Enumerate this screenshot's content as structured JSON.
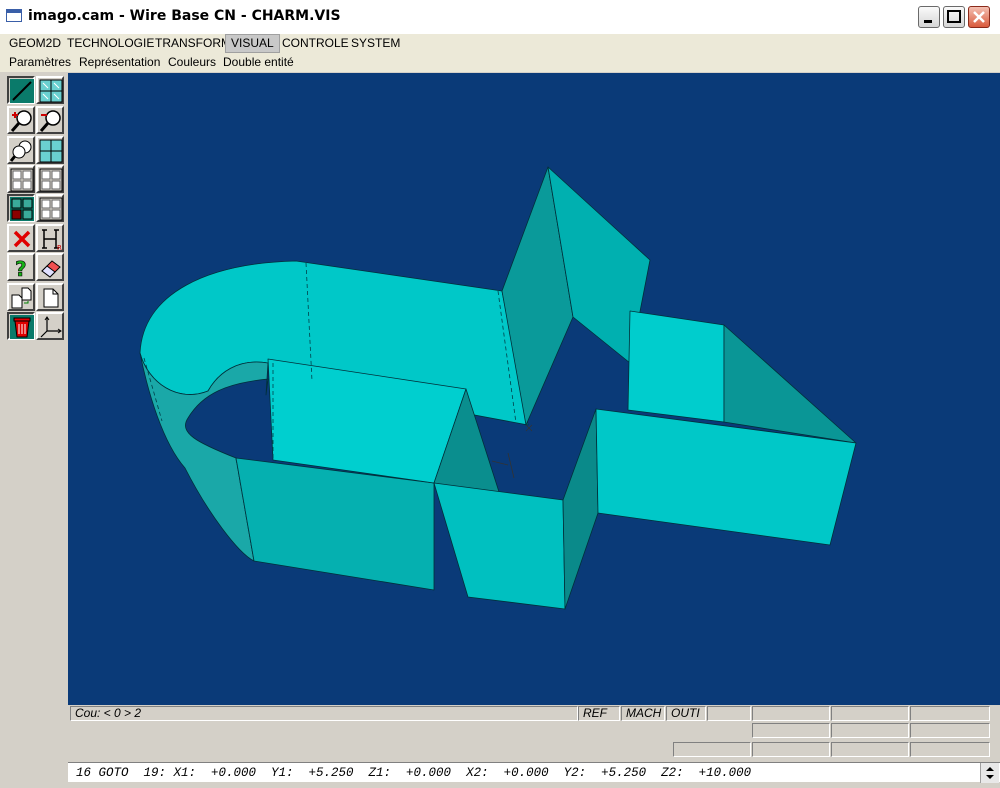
{
  "window": {
    "title": "imago.cam - Wire Base CN - CHARM.VIS"
  },
  "menu": {
    "items": [
      {
        "label": "GEOM2D"
      },
      {
        "label": "TECHNOLOGIE"
      },
      {
        "label": "TRANSFORM"
      },
      {
        "label": "VISUAL",
        "active": true
      },
      {
        "label": "CONTROLE"
      },
      {
        "label": "SYSTEM"
      }
    ]
  },
  "submenu": {
    "items": [
      {
        "label": "Paramètres"
      },
      {
        "label": "Représentation"
      },
      {
        "label": "Couleurs"
      },
      {
        "label": "Double entité"
      }
    ]
  },
  "toolbar": {
    "buttons": [
      "line-tool-icon",
      "grid-tool-icon",
      "zoom-in-icon",
      "zoom-out-icon",
      "zoom-window-icon",
      "grid-view-icon",
      "quad-view-icon",
      "quad-view-alt-icon",
      "layer-select-icon",
      "grid-select-icon",
      "delete-icon",
      "reference-icon",
      "help-icon",
      "eraser-icon",
      "copy-page-icon",
      "page-icon",
      "trash-icon",
      "axis-icon"
    ]
  },
  "status": {
    "cou": "Cou: < 0 > 2",
    "ref": "REF",
    "mach": "MACH",
    "outi": "OUTI"
  },
  "command_line": "16 GOTO  19: X1:  +0.000  Y1:  +5.250  Z1:  +0.000  X2:  +0.000  Y2:  +5.250  Z2:  +10.000",
  "colors": {
    "viewport_bg": "#0a3a78",
    "surface_light": "#00cdcd",
    "surface_dark": "#009c9c"
  }
}
